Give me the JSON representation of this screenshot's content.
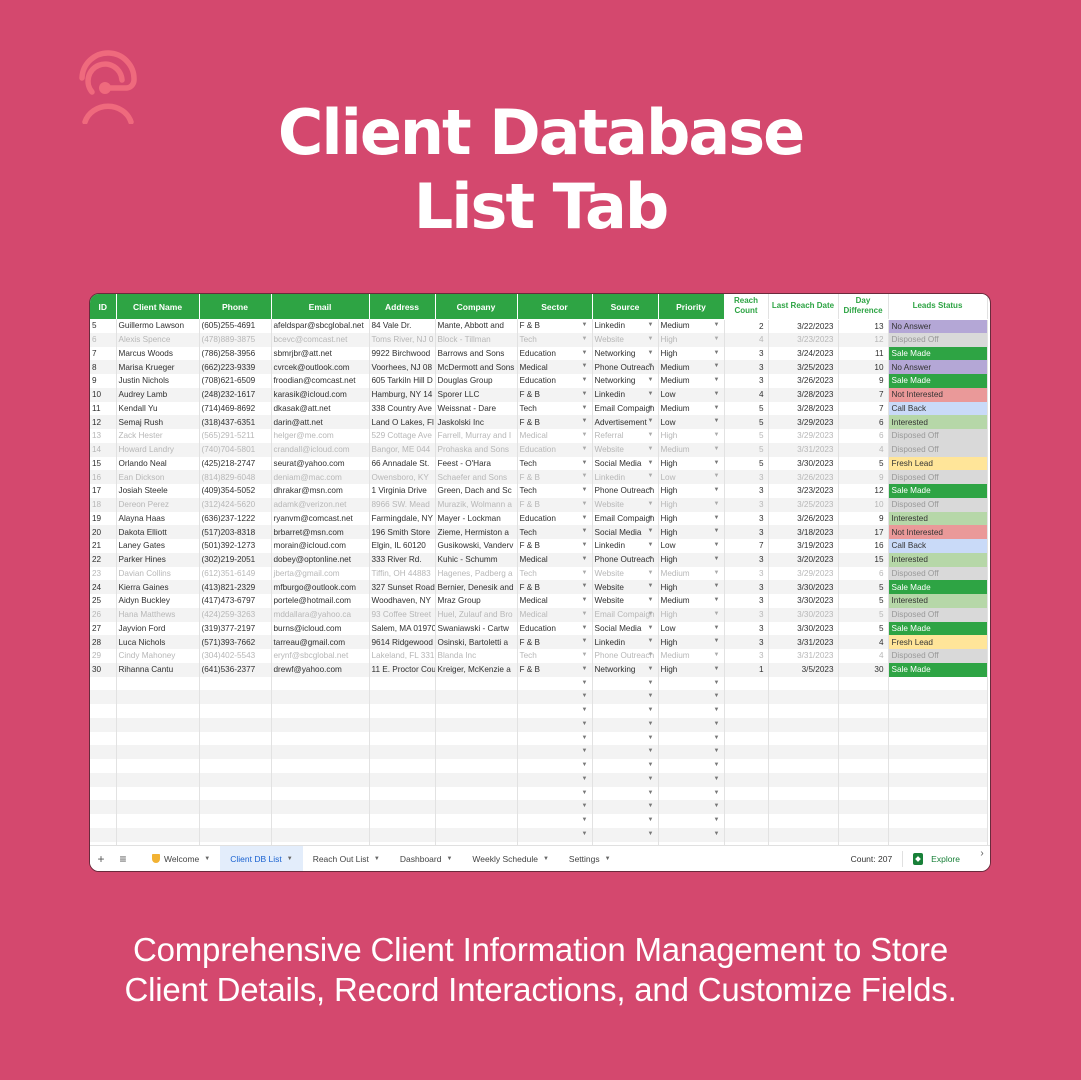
{
  "brand": {
    "logo_icon": "headset-person-icon",
    "accent": "#d4486e",
    "logo_color": "#ef6a7d"
  },
  "headline": {
    "line1": "Client Database",
    "line2": "List Tab"
  },
  "subline": {
    "line1": "Comprehensive Client Information Management to Store",
    "line2": "Client Details, Record Interactions, and Customize Fields."
  },
  "sheet": {
    "header_color": "#2ea444",
    "columns": [
      "ID",
      "Client Name",
      "Phone",
      "Email",
      "Address",
      "Company",
      "Sector",
      "Source",
      "Priority",
      "Reach Count",
      "Last Reach Date",
      "Day Difference",
      "Leads Status"
    ],
    "rows": [
      {
        "id": "5",
        "name": "Guillermo Lawson",
        "phone": "(605)255-4691",
        "email": "afeldspar@sbcglobal.net",
        "address": "84 Vale Dr.",
        "company": "Mante, Abbott and",
        "sector": "F & B",
        "source": "Linkedin",
        "priority": "Medium",
        "reach": "2",
        "date": "3/22/2023",
        "diff": "13",
        "status": "No Answer",
        "faded": false
      },
      {
        "id": "6",
        "name": "Alexis Spence",
        "phone": "(478)889-3875",
        "email": "bcevc@comcast.net",
        "address": "Toms River, NJ 0",
        "company": "Block - Tillman",
        "sector": "Tech",
        "source": "Website",
        "priority": "High",
        "reach": "4",
        "date": "3/23/2023",
        "diff": "12",
        "status": "Disposed Off",
        "faded": true
      },
      {
        "id": "7",
        "name": "Marcus Woods",
        "phone": "(786)258-3956",
        "email": "sbmrjbr@att.net",
        "address": "9922 Birchwood",
        "company": "Barrows and Sons",
        "sector": "Education",
        "source": "Networking",
        "priority": "High",
        "reach": "3",
        "date": "3/24/2023",
        "diff": "11",
        "status": "Sale Made",
        "faded": false
      },
      {
        "id": "8",
        "name": "Marisa Krueger",
        "phone": "(662)223-9339",
        "email": "cvrcek@outlook.com",
        "address": "Voorhees, NJ 08",
        "company": "McDermott and Sons",
        "sector": "Medical",
        "source": "Phone Outreach",
        "priority": "Medium",
        "reach": "3",
        "date": "3/25/2023",
        "diff": "10",
        "status": "No Answer",
        "faded": false
      },
      {
        "id": "9",
        "name": "Justin Nichols",
        "phone": "(708)621-6509",
        "email": "froodian@comcast.net",
        "address": "605 Tarkiln Hill D",
        "company": "Douglas Group",
        "sector": "Education",
        "source": "Networking",
        "priority": "Medium",
        "reach": "3",
        "date": "3/26/2023",
        "diff": "9",
        "status": "Sale Made",
        "faded": false
      },
      {
        "id": "10",
        "name": "Audrey Lamb",
        "phone": "(248)232-1617",
        "email": "karasik@icloud.com",
        "address": "Hamburg, NY 14",
        "company": "Sporer LLC",
        "sector": "F & B",
        "source": "Linkedin",
        "priority": "Low",
        "reach": "4",
        "date": "3/28/2023",
        "diff": "7",
        "status": "Not Interested",
        "faded": false
      },
      {
        "id": "11",
        "name": "Kendall Yu",
        "phone": "(714)469-8692",
        "email": "dkasak@att.net",
        "address": "338 Country Ave",
        "company": "Weissnat - Dare",
        "sector": "Tech",
        "source": "Email Compaign",
        "priority": "Medium",
        "reach": "5",
        "date": "3/28/2023",
        "diff": "7",
        "status": "Call Back",
        "faded": false
      },
      {
        "id": "12",
        "name": "Semaj Rush",
        "phone": "(318)437-6351",
        "email": "darin@att.net",
        "address": "Land O Lakes, Fl",
        "company": "Jaskolski Inc",
        "sector": "F & B",
        "source": "Advertisement",
        "priority": "Low",
        "reach": "5",
        "date": "3/29/2023",
        "diff": "6",
        "status": "Interested",
        "faded": false
      },
      {
        "id": "13",
        "name": "Zack Hester",
        "phone": "(565)291-5211",
        "email": "helger@me.com",
        "address": "529 Cottage Ave",
        "company": "Farrell, Murray and I",
        "sector": "Medical",
        "source": "Referral",
        "priority": "High",
        "reach": "5",
        "date": "3/29/2023",
        "diff": "6",
        "status": "Disposed Off",
        "faded": true
      },
      {
        "id": "14",
        "name": "Howard Landry",
        "phone": "(740)704-5801",
        "email": "crandall@icloud.com",
        "address": "Bangor, ME 044",
        "company": "Prohaska and Sons",
        "sector": "Education",
        "source": "Website",
        "priority": "Medium",
        "reach": "5",
        "date": "3/31/2023",
        "diff": "4",
        "status": "Disposed Off",
        "faded": true
      },
      {
        "id": "15",
        "name": "Orlando Neal",
        "phone": "(425)218-2747",
        "email": "seurat@yahoo.com",
        "address": "66 Annadale St.",
        "company": "Feest - O'Hara",
        "sector": "Tech",
        "source": "Social Media",
        "priority": "High",
        "reach": "5",
        "date": "3/30/2023",
        "diff": "5",
        "status": "Fresh Lead",
        "faded": false
      },
      {
        "id": "16",
        "name": "Ean Dickson",
        "phone": "(814)829-6048",
        "email": "deniam@mac.com",
        "address": "Owensboro, KY",
        "company": "Schaefer and Sons",
        "sector": "F & B",
        "source": "Linkedin",
        "priority": "Low",
        "reach": "3",
        "date": "3/26/2023",
        "diff": "9",
        "status": "Disposed Off",
        "faded": true
      },
      {
        "id": "17",
        "name": "Josiah Steele",
        "phone": "(409)354-5052",
        "email": "dhrakar@msn.com",
        "address": "1 Virginia Drive",
        "company": "Green, Dach and Sc",
        "sector": "Tech",
        "source": "Phone Outreach",
        "priority": "High",
        "reach": "3",
        "date": "3/23/2023",
        "diff": "12",
        "status": "Sale Made",
        "faded": false
      },
      {
        "id": "18",
        "name": "Dereon Perez",
        "phone": "(312)424-5620",
        "email": "adamk@verizon.net",
        "address": "8966 SW. Mead",
        "company": "Murazik, Wolmann a",
        "sector": "F & B",
        "source": "Website",
        "priority": "High",
        "reach": "3",
        "date": "3/25/2023",
        "diff": "10",
        "status": "Disposed Off",
        "faded": true
      },
      {
        "id": "19",
        "name": "Alayna Haas",
        "phone": "(636)237-1222",
        "email": "ryanvm@comcast.net",
        "address": "Farmingdale, NY",
        "company": "Mayer - Lockman",
        "sector": "Education",
        "source": "Email Compaign",
        "priority": "High",
        "reach": "3",
        "date": "3/26/2023",
        "diff": "9",
        "status": "Interested",
        "faded": false
      },
      {
        "id": "20",
        "name": "Dakota Elliott",
        "phone": "(517)203-8318",
        "email": "brbarret@msn.com",
        "address": "196 Smith Store",
        "company": "Zieme, Hermiston a",
        "sector": "Tech",
        "source": "Social Media",
        "priority": "High",
        "reach": "3",
        "date": "3/18/2023",
        "diff": "17",
        "status": "Not Interested",
        "faded": false
      },
      {
        "id": "21",
        "name": "Laney Gates",
        "phone": "(501)392-1273",
        "email": "morain@icloud.com",
        "address": "Elgin, IL 60120",
        "company": "Gusikowski, Vanderv",
        "sector": "F & B",
        "source": "Linkedin",
        "priority": "Low",
        "reach": "7",
        "date": "3/19/2023",
        "diff": "16",
        "status": "Call Back",
        "faded": false
      },
      {
        "id": "22",
        "name": "Parker Hines",
        "phone": "(302)219-2051",
        "email": "dobey@optonline.net",
        "address": "333 River Rd.",
        "company": "Kuhic - Schumm",
        "sector": "Medical",
        "source": "Phone Outreach",
        "priority": "High",
        "reach": "3",
        "date": "3/20/2023",
        "diff": "15",
        "status": "Interested",
        "faded": false
      },
      {
        "id": "23",
        "name": "Davian Collins",
        "phone": "(612)351-6149",
        "email": "jberta@gmail.com",
        "address": "Tiffin, OH 44883",
        "company": "Hagenes, Padberg a",
        "sector": "Tech",
        "source": "Website",
        "priority": "Medium",
        "reach": "3",
        "date": "3/29/2023",
        "diff": "6",
        "status": "Disposed Off",
        "faded": true
      },
      {
        "id": "24",
        "name": "Kierra Gaines",
        "phone": "(413)821-2329",
        "email": "mfburgo@outlook.com",
        "address": "327 Sunset Road",
        "company": "Bernier, Denesik and",
        "sector": "F & B",
        "source": "Website",
        "priority": "High",
        "reach": "3",
        "date": "3/30/2023",
        "diff": "5",
        "status": "Sale Made",
        "faded": false
      },
      {
        "id": "25",
        "name": "Aidyn Buckley",
        "phone": "(417)473-6797",
        "email": "portele@hotmail.com",
        "address": "Woodhaven, NY",
        "company": "Mraz Group",
        "sector": "Medical",
        "source": "Website",
        "priority": "Medium",
        "reach": "3",
        "date": "3/30/2023",
        "diff": "5",
        "status": "Interested",
        "faded": false
      },
      {
        "id": "26",
        "name": "Hana Matthews",
        "phone": "(424)259-3263",
        "email": "mddallara@yahoo.ca",
        "address": "93 Coffee Street",
        "company": "Huel, Zulauf and Bro",
        "sector": "Medical",
        "source": "Email Compaign",
        "priority": "High",
        "reach": "3",
        "date": "3/30/2023",
        "diff": "5",
        "status": "Disposed Off",
        "faded": true
      },
      {
        "id": "27",
        "name": "Jayvion Ford",
        "phone": "(319)377-2197",
        "email": "burns@icloud.com",
        "address": "Salem, MA 01970",
        "company": "Swaniawski - Cartw",
        "sector": "Education",
        "source": "Social Media",
        "priority": "Low",
        "reach": "3",
        "date": "3/30/2023",
        "diff": "5",
        "status": "Sale Made",
        "faded": false
      },
      {
        "id": "28",
        "name": "Luca Nichols",
        "phone": "(571)393-7662",
        "email": "tarreau@gmail.com",
        "address": "9614 Ridgewood",
        "company": "Osinski, Bartoletti a",
        "sector": "F & B",
        "source": "Linkedin",
        "priority": "High",
        "reach": "3",
        "date": "3/31/2023",
        "diff": "4",
        "status": "Fresh Lead",
        "faded": false
      },
      {
        "id": "29",
        "name": "Cindy Mahoney",
        "phone": "(304)402-5543",
        "email": "erynf@sbcglobal.net",
        "address": "Lakeland, FL 331",
        "company": "Blanda Inc",
        "sector": "Tech",
        "source": "Phone Outreach",
        "priority": "Medium",
        "reach": "3",
        "date": "3/31/2023",
        "diff": "4",
        "status": "Disposed Off",
        "faded": true
      },
      {
        "id": "30",
        "name": "Rihanna Cantu",
        "phone": "(641)536-2377",
        "email": "drewf@yahoo.com",
        "address": "11 E. Proctor Cou",
        "company": "Kreiger, McKenzie a",
        "sector": "F & B",
        "source": "Networking",
        "priority": "High",
        "reach": "1",
        "date": "3/5/2023",
        "diff": "30",
        "status": "Sale Made",
        "faded": false
      }
    ],
    "empty_rows": 13,
    "status_colors": {
      "No Answer": "#b4a7d6",
      "Disposed Off": "#d9d9d9",
      "Sale Made": "#2ea444",
      "Not Interested": "#ea9999",
      "Call Back": "#c9daf8",
      "Interested": "#b6d7a8",
      "Fresh Lead": "#ffe599"
    }
  },
  "tabbar": {
    "add_icon": "+",
    "menu_icon": "≡",
    "tabs": [
      {
        "label": "Welcome",
        "icon": "shield-icon",
        "active": false
      },
      {
        "label": "Client DB List",
        "active": true
      },
      {
        "label": "Reach Out List",
        "active": false
      },
      {
        "label": "Dashboard",
        "active": false
      },
      {
        "label": "Weekly Schedule",
        "active": false
      },
      {
        "label": "Settings",
        "active": false
      }
    ],
    "count": "Count: 207",
    "explore": "Explore",
    "next_icon": "›"
  }
}
